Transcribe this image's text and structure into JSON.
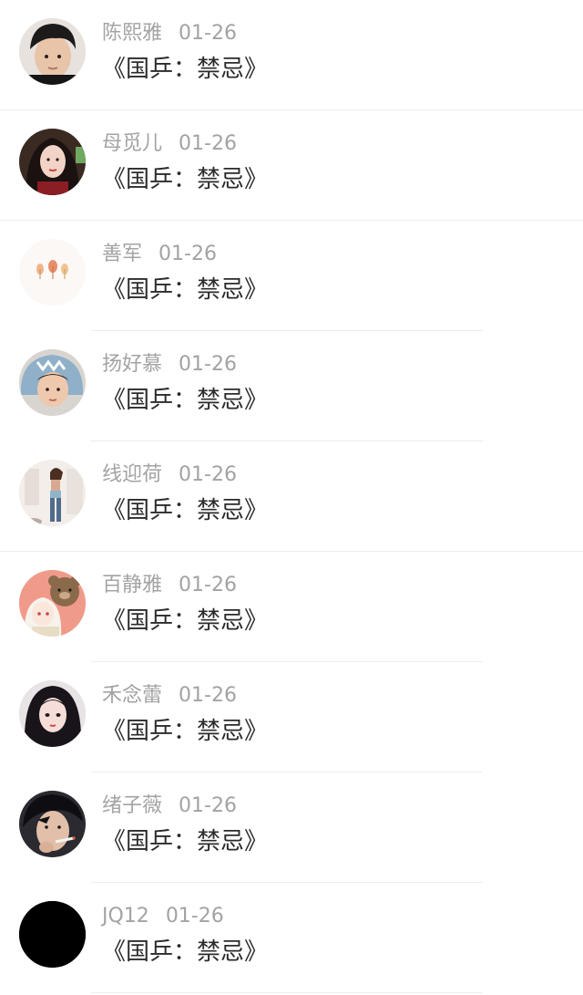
{
  "feed": {
    "items": [
      {
        "author": "陈熙雅",
        "date": "01-26",
        "title": "《国乒：禁忌》",
        "avatar_icon": "avatar-young-man-icon"
      },
      {
        "author": "母觅儿",
        "date": "01-26",
        "title": "《国乒：禁忌》",
        "avatar_icon": "avatar-woman-long-hair-icon"
      },
      {
        "author": "善军",
        "date": "01-26",
        "title": "《国乒：禁忌》",
        "avatar_icon": "avatar-autumn-leaves-icon"
      },
      {
        "author": "扬好慕",
        "date": "01-26",
        "title": "《国乒：禁忌》",
        "avatar_icon": "avatar-child-shark-hood-icon"
      },
      {
        "author": "线迎荷",
        "date": "01-26",
        "title": "《国乒：禁忌》",
        "avatar_icon": "avatar-woman-standing-icon"
      },
      {
        "author": "百静雅",
        "date": "01-26",
        "title": "《国乒：禁忌》",
        "avatar_icon": "avatar-anime-bear-icon"
      },
      {
        "author": "禾念蕾",
        "date": "01-26",
        "title": "《国乒：禁忌》",
        "avatar_icon": "avatar-girl-dark-hair-icon"
      },
      {
        "author": "绪子薇",
        "date": "01-26",
        "title": "《国乒：禁忌》",
        "avatar_icon": "avatar-man-smoking-icon"
      },
      {
        "author": "JQ12",
        "date": "01-26",
        "title": "《国乒：禁忌》",
        "avatar_icon": "avatar-black-circle-icon"
      }
    ]
  },
  "colors": {
    "meta_text": "#a3a3a3",
    "title_text": "#2b2b2b",
    "divider": "#ececec",
    "background": "#ffffff"
  }
}
